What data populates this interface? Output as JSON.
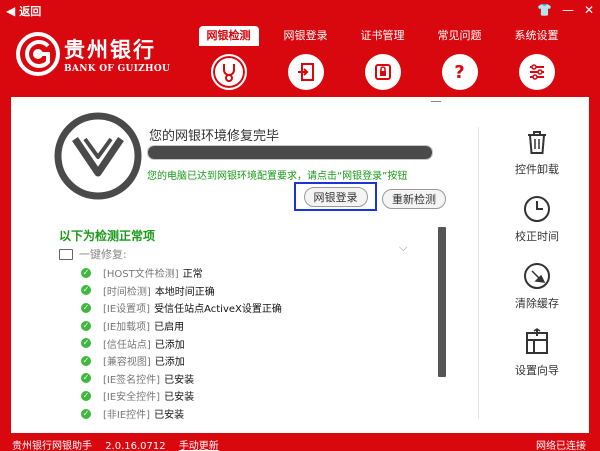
{
  "titlebar": {
    "back_label": "返回",
    "icons": [
      "back-arrow-icon",
      "shirt-icon",
      "minimize-icon",
      "close-icon"
    ]
  },
  "brand": {
    "name_cn": "贵州银行",
    "name_en": "BANK OF GUIZHOU",
    "accent": "#d9080f"
  },
  "nav": {
    "tabs": [
      {
        "label": "网银检测",
        "icon": "stethoscope-icon",
        "active": true
      },
      {
        "label": "网银登录",
        "icon": "login-icon",
        "active": false
      },
      {
        "label": "证书管理",
        "icon": "certificate-icon",
        "active": false
      },
      {
        "label": "常见问题",
        "icon": "question-icon",
        "active": false
      },
      {
        "label": "系统设置",
        "icon": "settings-icon",
        "active": false
      }
    ]
  },
  "main": {
    "status_title": "您的网银环境修复完毕",
    "progress": 1.0,
    "hint": "您的电脑已达到网银环境配置要求，请点击“网银登录”按钮",
    "login_button": "网银登录",
    "redetect_button": "重新检测",
    "list_heading": "以下为检测正常项",
    "oneclick_label": "一键修复:",
    "items": [
      {
        "key": "[HOST文件检测]",
        "value": "正常"
      },
      {
        "key": "[时间检测]",
        "value": "本地时间正确"
      },
      {
        "key": "[IE设置项]",
        "value": "受信任站点ActiveX设置正确"
      },
      {
        "key": "[IE加载项]",
        "value": "已启用"
      },
      {
        "key": "[信任站点]",
        "value": "已添加"
      },
      {
        "key": "[兼容视图]",
        "value": "已添加"
      },
      {
        "key": "[IE签名控件]",
        "value": "已安装"
      },
      {
        "key": "[IE安全控件]",
        "value": "已安装"
      },
      {
        "key": "[非IE控件]",
        "value": "已安装"
      }
    ]
  },
  "tools": [
    {
      "label": "控件卸载",
      "icon": "trash-icon"
    },
    {
      "label": "校正时间",
      "icon": "clock-icon"
    },
    {
      "label": "清除缓存",
      "icon": "broom-icon"
    },
    {
      "label": "设置向导",
      "icon": "wizard-icon"
    }
  ],
  "statusbar": {
    "app_name": "贵州银行网银助手",
    "version": "2.0.16.0712",
    "update_label": "手动更新",
    "network": "网络已连接"
  }
}
